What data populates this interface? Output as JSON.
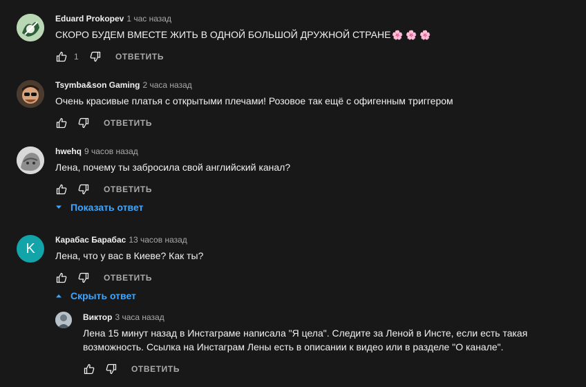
{
  "comments": [
    {
      "author": "Eduard Prokopev",
      "time": "1 час назад",
      "text": "СКОРО БУДЕМ ВМЕСТЕ ЖИТЬ В ОДНОЙ БОЛЬШОЙ ДРУЖНОЙ СТРАНЕ",
      "emoji": "🌸 🌸 🌸",
      "likes": "1",
      "reply_label": "ОТВЕТИТЬ"
    },
    {
      "author": "Tsymba&son Gaming",
      "time": "2 часа назад",
      "text": "Очень красивые платья с открытыми плечами! Розовое так ещё с офигенным триггером",
      "reply_label": "ОТВЕТИТЬ"
    },
    {
      "author": "hwehq",
      "time": "9 часов назад",
      "text": "Лена, почему ты забросила свой английский канал?",
      "reply_label": "ОТВЕТИТЬ",
      "toggle_label": "Показать ответ"
    },
    {
      "author": "Карабас Барабас",
      "time": "13 часов назад",
      "avatar_letter": "K",
      "text": "Лена, что у вас в Киеве? Как ты?",
      "reply_label": "ОТВЕТИТЬ",
      "toggle_label": "Скрыть ответ"
    }
  ],
  "reply": {
    "author": "Виктор",
    "time": "3 часа назад",
    "text": "Лена 15 минут назад в Инстаграме написала \"Я цела\". Следите за Леной в Инсте, если есть такая возможность. Ссылка на Инстаграм Лены есть в описании к видео или в разделе \"О канале\".",
    "reply_label": "ОТВЕТИТЬ"
  },
  "colors": {
    "background": "#181818",
    "text": "#f1f1f1",
    "secondary": "#aaaaaa",
    "link": "#3ea6ff",
    "avatar_k": "#12a4a9"
  },
  "icons": [
    "like-icon",
    "dislike-icon",
    "chevron-down-icon",
    "chevron-up-icon"
  ]
}
